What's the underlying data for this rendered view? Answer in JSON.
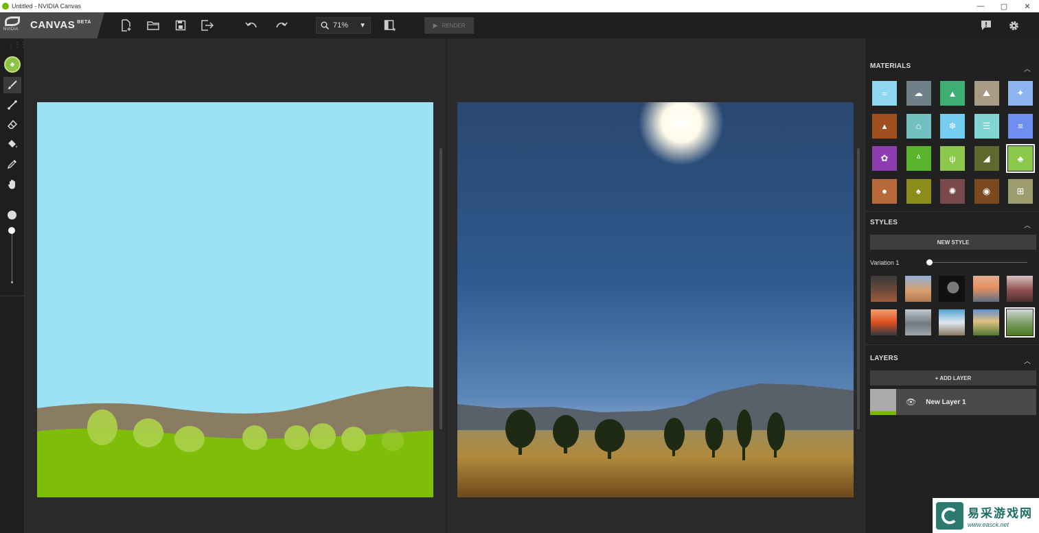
{
  "window": {
    "title": "Untitled - NVIDIA Canvas",
    "controls": [
      "—",
      "▢",
      "✕"
    ]
  },
  "brand": {
    "logo_text": "NVIDIA",
    "name": "CANVAS",
    "badge": "BETA"
  },
  "toolbar": {
    "icons": [
      "new-file-icon",
      "open-folder-icon",
      "save-icon",
      "export-icon",
      "undo-icon",
      "redo-icon",
      "swap-view-icon",
      "feedback-icon",
      "settings-icon"
    ],
    "zoom_value": "71%",
    "render_label": "RENDER"
  },
  "tools": {
    "items": [
      "active-material",
      "brush",
      "line",
      "eraser",
      "fill",
      "eyedropper",
      "pan"
    ],
    "brush_size_fraction": 0.1
  },
  "materials": {
    "title": "MATERIALS",
    "items": [
      {
        "name": "water",
        "color": "#8fd8f0"
      },
      {
        "name": "cloud",
        "color": "#708088"
      },
      {
        "name": "mountain",
        "color": "#3fae73"
      },
      {
        "name": "hill",
        "color": "#a99b86"
      },
      {
        "name": "sky",
        "color": "#8fb5f0"
      },
      {
        "name": "dirt",
        "color": "#a0501e"
      },
      {
        "name": "house",
        "color": "#72c0bf"
      },
      {
        "name": "snow",
        "color": "#74cdf0"
      },
      {
        "name": "fog",
        "color": "#80d4d4"
      },
      {
        "name": "river",
        "color": "#6f8ef0"
      },
      {
        "name": "flower",
        "color": "#8e3db0"
      },
      {
        "name": "grass",
        "color": "#5ab52c"
      },
      {
        "name": "tall-grass",
        "color": "#8cc84b"
      },
      {
        "name": "rock",
        "color": "#5e6a2d"
      },
      {
        "name": "bush",
        "color": "#8cc84b"
      },
      {
        "name": "sand",
        "color": "#b86a3c"
      },
      {
        "name": "tree",
        "color": "#8c8c1a"
      },
      {
        "name": "gravel",
        "color": "#7a4a4a"
      },
      {
        "name": "stone",
        "color": "#7a4a1e"
      },
      {
        "name": "wood",
        "color": "#9c9c6e"
      }
    ],
    "selected_index": 14
  },
  "styles": {
    "title": "STYLES",
    "new_style_label": "NEW STYLE",
    "variation_label": "Variation 1",
    "variation_fraction": 0.02,
    "selected_index": 9
  },
  "layers": {
    "title": "LAYERS",
    "add_label": "+ ADD LAYER",
    "items": [
      {
        "name": "New Layer 1"
      }
    ]
  },
  "watermark": {
    "cn": "易采游戏网",
    "url": "www.easck.net"
  },
  "colors": {
    "accent": "#76b900",
    "paint_sky": "#9de1f5",
    "paint_ground": "#7fbd0b",
    "paint_hill": "#8a7c62",
    "paint_bush": "#acd149"
  }
}
